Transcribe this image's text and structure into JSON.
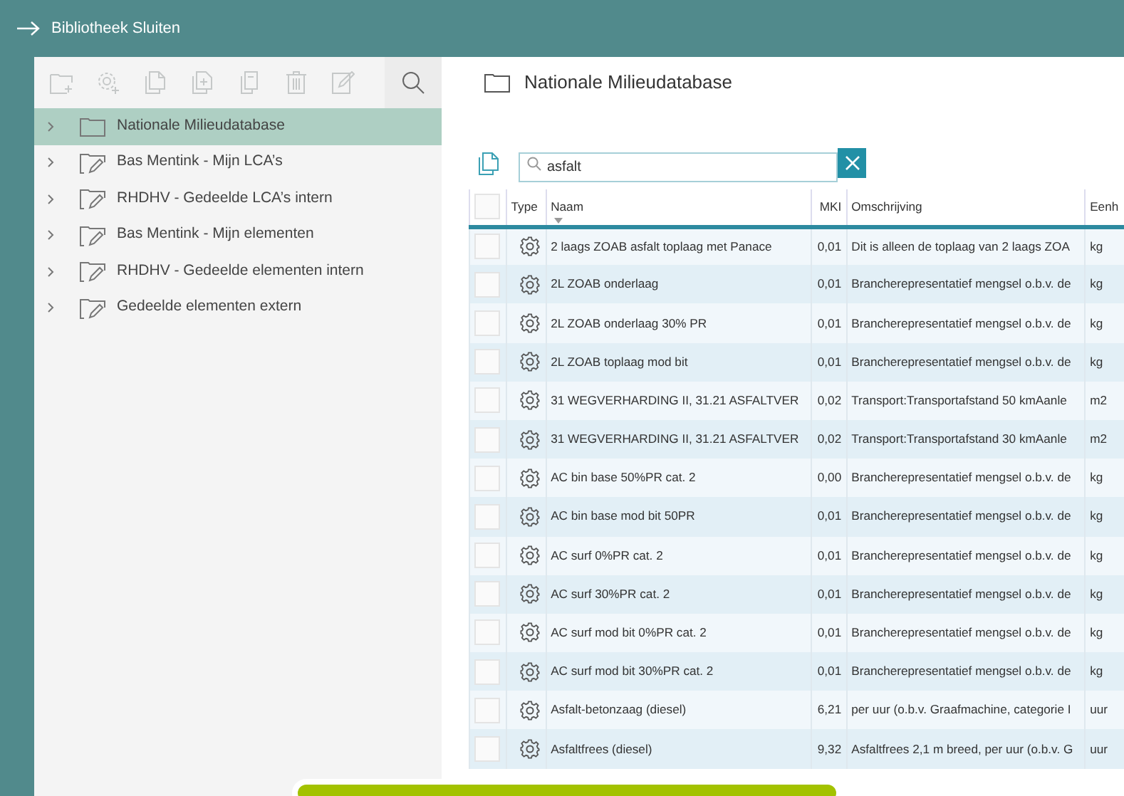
{
  "topbar": {
    "title": "Bibliotheek Sluiten"
  },
  "toolbar": [
    {
      "kind": "new-folder",
      "disabled": true
    },
    {
      "kind": "new-element",
      "disabled": true
    },
    {
      "kind": "copy",
      "disabled": true
    },
    {
      "kind": "paste",
      "disabled": true
    },
    {
      "kind": "duplicate",
      "disabled": true
    },
    {
      "kind": "delete",
      "disabled": true
    },
    {
      "kind": "edit",
      "disabled": true
    },
    {
      "kind": "search",
      "disabled": false
    }
  ],
  "sidebar": {
    "items": [
      {
        "label": "Nationale Milieudatabase",
        "kind": "plain",
        "selected": true,
        "expanded": false
      },
      {
        "label": "Bas Mentink - Mijn LCA’s",
        "kind": "editable",
        "selected": false,
        "expanded": false
      },
      {
        "label": "RHDHV - Gedeelde LCA’s intern",
        "kind": "editable",
        "selected": false,
        "expanded": false
      },
      {
        "label": "Bas Mentink - Mijn elementen",
        "kind": "editable",
        "selected": false,
        "expanded": false
      },
      {
        "label": "RHDHV - Gedeelde elementen intern",
        "kind": "editable",
        "selected": false,
        "expanded": false
      },
      {
        "label": "Gedeelde elementen extern",
        "kind": "editable",
        "selected": false,
        "expanded": false
      }
    ]
  },
  "panel": {
    "title": "Nationale Milieudatabase"
  },
  "search": {
    "value": "asfalt"
  },
  "table": {
    "select_all": {
      "checked": false
    },
    "columns": [
      {
        "label": "Type",
        "sorted": false
      },
      {
        "label": "Naam",
        "sorted": true
      },
      {
        "label": "MKI",
        "sorted": false
      },
      {
        "label": "Omschrijving",
        "sorted": false
      },
      {
        "label": "Eenh",
        "sorted": false
      }
    ],
    "rows": [
      {
        "checked": false,
        "naam": "2 laags ZOAB asfalt toplaag met Panace",
        "mki": "0,01",
        "omschrijving": "Dit is alleen de toplaag van 2 laags ZOA",
        "eenheid": "kg"
      },
      {
        "checked": false,
        "naam": "2L ZOAB onderlaag",
        "mki": "0,01",
        "omschrijving": "Brancherepresentatief mengsel o.b.v. de",
        "eenheid": "kg"
      },
      {
        "checked": false,
        "naam": "2L ZOAB onderlaag 30% PR",
        "mki": "0,01",
        "omschrijving": "Brancherepresentatief mengsel o.b.v. de",
        "eenheid": "kg"
      },
      {
        "checked": false,
        "naam": "2L ZOAB toplaag mod bit",
        "mki": "0,01",
        "omschrijving": "Brancherepresentatief mengsel o.b.v. de",
        "eenheid": "kg"
      },
      {
        "checked": false,
        "naam": "31 WEGVERHARDING II, 31.21 ASFALTVER",
        "mki": "0,02",
        "omschrijving": "Transport:Transportafstand 50 kmAanle",
        "eenheid": "m2"
      },
      {
        "checked": false,
        "naam": "31 WEGVERHARDING II, 31.21 ASFALTVER",
        "mki": "0,02",
        "omschrijving": "Transport:Transportafstand 30 kmAanle",
        "eenheid": "m2"
      },
      {
        "checked": false,
        "naam": "AC bin base 50%PR cat. 2",
        "mki": "0,00",
        "omschrijving": "Brancherepresentatief mengsel o.b.v. de",
        "eenheid": "kg"
      },
      {
        "checked": false,
        "naam": "AC bin base mod bit 50PR",
        "mki": "0,01",
        "omschrijving": "Brancherepresentatief mengsel o.b.v. de",
        "eenheid": "kg"
      },
      {
        "checked": false,
        "naam": "AC surf 0%PR cat. 2",
        "mki": "0,01",
        "omschrijving": "Brancherepresentatief mengsel o.b.v. de",
        "eenheid": "kg"
      },
      {
        "checked": false,
        "naam": "AC surf 30%PR cat. 2",
        "mki": "0,01",
        "omschrijving": "Brancherepresentatief mengsel o.b.v. de",
        "eenheid": "kg"
      },
      {
        "checked": false,
        "naam": "AC surf mod bit 0%PR cat. 2",
        "mki": "0,01",
        "omschrijving": "Brancherepresentatief mengsel o.b.v. de",
        "eenheid": "kg"
      },
      {
        "checked": false,
        "naam": "AC surf mod bit 30%PR cat. 2",
        "mki": "0,01",
        "omschrijving": "Brancherepresentatief mengsel o.b.v. de",
        "eenheid": "kg"
      },
      {
        "checked": false,
        "naam": "Asfalt-betonzaag (diesel)",
        "mki": "6,21",
        "omschrijving": "per uur (o.b.v. Graafmachine, categorie I",
        "eenheid": "uur"
      },
      {
        "checked": false,
        "naam": "Asfaltfrees (diesel)",
        "mki": "9,32",
        "omschrijving": "Asfaltfrees 2,1 m breed, per uur (o.b.v. G",
        "eenheid": "uur"
      }
    ]
  }
}
